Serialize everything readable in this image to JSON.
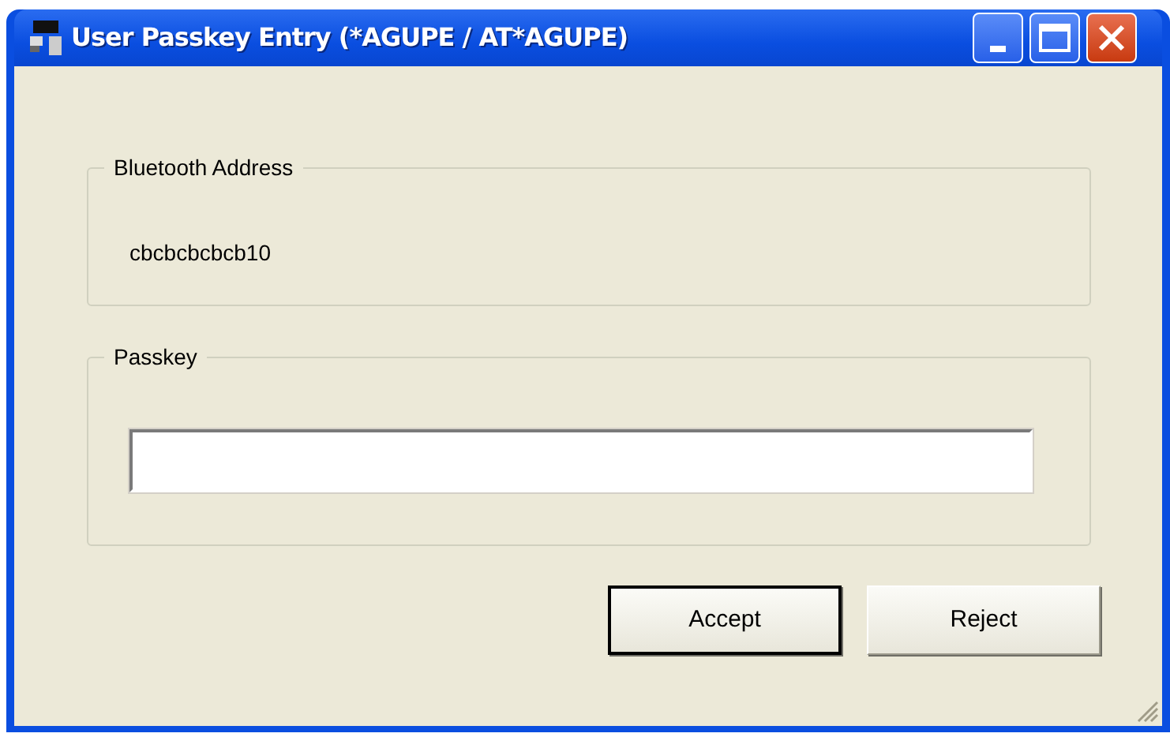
{
  "window": {
    "title": "User Passkey Entry (*AGUPE / AT*AGUPE)"
  },
  "address_group": {
    "legend": "Bluetooth Address",
    "value": "cbcbcbcbcb10"
  },
  "passkey_group": {
    "legend": "Passkey"
  },
  "buttons": [
    {
      "label": "Accept",
      "default": true
    },
    {
      "label": "Reject",
      "default": false
    }
  ]
}
